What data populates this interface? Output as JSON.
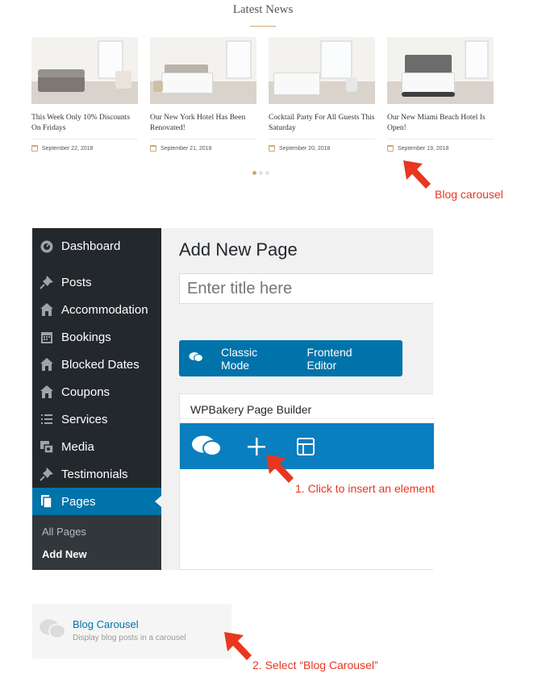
{
  "latest_news": {
    "title": "Latest News",
    "posts": [
      {
        "title": "This Week Only 10% Discounts On Fridays",
        "date": "September 22, 2018"
      },
      {
        "title": "Our New York Hotel Has Been Renovated!",
        "date": "September 21, 2018"
      },
      {
        "title": "Cocktail Party For All Guests This Saturday",
        "date": "September 20, 2018"
      },
      {
        "title": "Our New Miami Beach Hotel Is Open!",
        "date": "September 19, 2018"
      }
    ],
    "pagination_active": 1,
    "pagination_total": 3,
    "accent_color": "#c9a978"
  },
  "annotations": {
    "blog_carousel": "Blog carousel",
    "step1": "1. Click to insert an element",
    "step2": "2. Select “Blog Carousel”",
    "color": "#e8371e"
  },
  "wp_admin": {
    "menu": [
      {
        "label": "Dashboard",
        "icon": "dashboard-icon"
      },
      {
        "label": "Posts",
        "icon": "pin-icon"
      },
      {
        "label": "Accommodation",
        "icon": "home-icon"
      },
      {
        "label": "Bookings",
        "icon": "calendar-icon"
      },
      {
        "label": "Blocked Dates",
        "icon": "home-icon"
      },
      {
        "label": "Coupons",
        "icon": "home-icon"
      },
      {
        "label": "Services",
        "icon": "list-icon"
      },
      {
        "label": "Media",
        "icon": "media-icon"
      },
      {
        "label": "Testimonials",
        "icon": "pin-icon"
      },
      {
        "label": "Pages",
        "icon": "pages-icon"
      }
    ],
    "submenu": [
      {
        "label": "All Pages"
      },
      {
        "label": "Add New"
      }
    ],
    "page_heading": "Add New Page",
    "title_placeholder": "Enter title here",
    "mode_bar": {
      "classic": "Classic Mode",
      "frontend": "Frontend Editor"
    },
    "builder_title": "WPBakery Page Builder",
    "colors": {
      "sidebar": "#23282d",
      "active": "#0073aa"
    }
  },
  "element": {
    "name": "Blog Carousel",
    "description": "Display blog posts in a carousel"
  }
}
